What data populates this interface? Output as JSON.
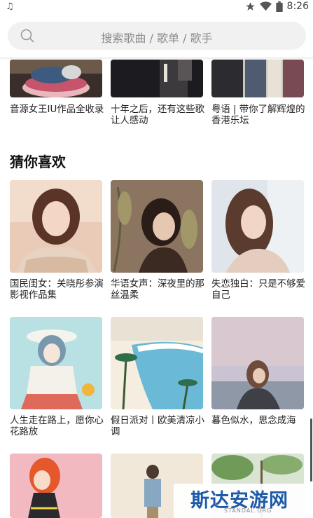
{
  "status_bar": {
    "time": "8:26"
  },
  "search": {
    "placeholder": "搜索歌曲 / 歌单 / 歌手"
  },
  "top_playlists": [
    {
      "title": "音源女王IU作品全收录"
    },
    {
      "title": "十年之后，还有这些歌让人感动"
    },
    {
      "title": "粤语 | 带你了解辉煌的香港乐坛"
    }
  ],
  "section": {
    "title": "猜你喜欢"
  },
  "recommended": [
    {
      "title": "国民闺女：关晓彤参演影视作品集"
    },
    {
      "title": "华语女声：深夜里的那丝温柔"
    },
    {
      "title": "失恋独白：只是不够爱自己"
    },
    {
      "title": "人生走在路上，愿你心花路放"
    },
    {
      "title": "假日派对丨欧美清凉小调"
    },
    {
      "title": "暮色似水，思念成海"
    }
  ],
  "watermark": {
    "text": "斯达安游网",
    "sub": "STANDAL.ORG"
  }
}
